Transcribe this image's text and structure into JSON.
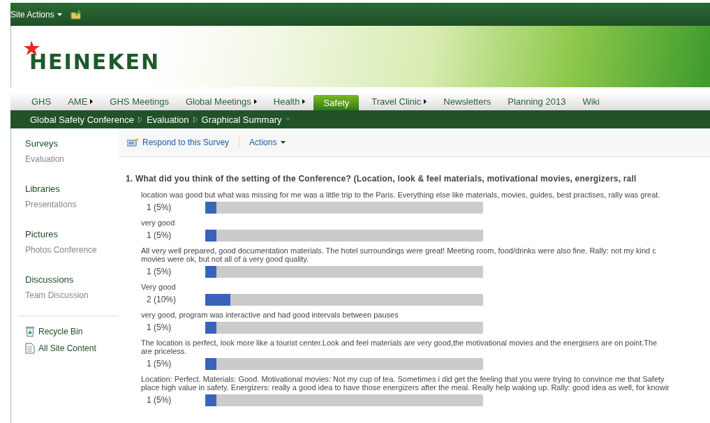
{
  "top_bar": {
    "site_actions": "Site Actions"
  },
  "logo": {
    "text": "HEINEKEN"
  },
  "tabs": [
    {
      "label": "GHS",
      "selected": false,
      "submenu": false
    },
    {
      "label": "AME",
      "selected": false,
      "submenu": true
    },
    {
      "label": "GHS Meetings",
      "selected": false,
      "submenu": false
    },
    {
      "label": "Global Meetings",
      "selected": false,
      "submenu": true
    },
    {
      "label": "Health",
      "selected": false,
      "submenu": true
    },
    {
      "label": "Safety",
      "selected": true,
      "submenu": false
    },
    {
      "label": "Travel Clinic",
      "selected": false,
      "submenu": true
    },
    {
      "label": "Newsletters",
      "selected": false,
      "submenu": false
    },
    {
      "label": "Planning 2013",
      "selected": false,
      "submenu": false
    },
    {
      "label": "Wiki",
      "selected": false,
      "submenu": false
    }
  ],
  "breadcrumb": [
    "Global Safety Conference",
    "Evaluation",
    "Graphical Summary"
  ],
  "sidebar": {
    "groups": [
      {
        "title": "Surveys",
        "items": [
          "Evaluation"
        ]
      },
      {
        "title": "Libraries",
        "items": [
          "Presentations"
        ]
      },
      {
        "title": "Pictures",
        "items": [
          "Photos Conference"
        ]
      },
      {
        "title": "Discussions",
        "items": [
          "Team Discussion"
        ]
      }
    ],
    "links": [
      {
        "kind": "recycle",
        "label": "Recycle Bin"
      },
      {
        "kind": "content",
        "label": "All Site Content"
      }
    ]
  },
  "toolbar": {
    "respond": "Respond to this Survey",
    "actions": "Actions"
  },
  "question": {
    "title": "1. What did you think of the setting of the Conference? (Location,  look & feel materials, motivational movies, energizers, rall",
    "answers": [
      {
        "lines": [
          "location was good but what was missing for me was a little trip to the Paris. Everything else like materials, movies, guides, best practises, rally was great."
        ],
        "count": "1 (5%)",
        "level": 0.04
      },
      {
        "lines": [
          "very good"
        ],
        "count": "1 (5%)",
        "level": 0.04
      },
      {
        "lines": [
          "All very well prepared, good documentation materials. The hotel surroundings were great! Meeting room, food/drinks were also fine. Rally: not my kind c",
          "movies were ok, but not all of a very good quality."
        ],
        "count": "1 (5%)",
        "level": 0.04
      },
      {
        "lines": [
          "Very good"
        ],
        "count": "2 (10%)",
        "level": 0.09
      },
      {
        "lines": [
          "very good, program was interactive and had good intervals between pauses"
        ],
        "count": "1 (5%)",
        "level": 0.04
      },
      {
        "lines": [
          "The location is perfect, look more like a tourist center.Look and feel materials are very good,the motivational movies and the energisers are on point.The",
          "are priceless."
        ],
        "count": "1 (5%)",
        "level": 0.04
      },
      {
        "lines": [
          "Location: Perfect. Materials: Good. Motivational movies: Not my cup of tea. Sometimes i did get the feeling that you were trying to convince me that Safety",
          "place high value in safety. Energizers: really a good idea to have those energizers after the meal. Really help waking up. Rally: good idea as well, for knowir"
        ],
        "count": "1 (5%)",
        "level": 0.04
      }
    ]
  }
}
